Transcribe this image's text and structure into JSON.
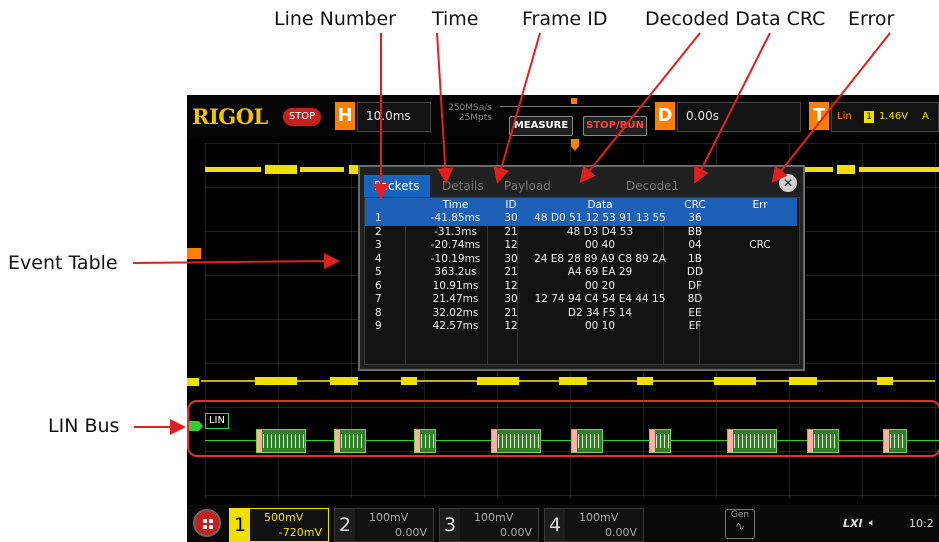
{
  "callouts": {
    "line_number": "Line Number",
    "time": "Time",
    "frame_id": "Frame ID",
    "decoded_data_crc": "Decoded Data CRC",
    "error": "Error",
    "event_table": "Event Table",
    "lin_bus": "LIN Bus"
  },
  "colors": {
    "callout_arrow": "#e02020",
    "accent_blue": "#1e5fb8",
    "trigger_orange": "#ff7f00",
    "channel1_yellow": "#f0e000",
    "lin_green": "#2ad12a"
  },
  "topbar": {
    "brand": "RIGOL",
    "run_state": "STOP",
    "horizontal_badge": "H",
    "timebase": "10.0ms",
    "sample_rate": "250MSa/s",
    "memory_depth": "25Mpts",
    "measure_label": "MEASURE",
    "stop_run_label": "STOP/RUN",
    "delay_badge": "D",
    "delay_value": "0.00s",
    "trigger_badge": "T",
    "trigger_type": "Lin",
    "trigger_channel": "1",
    "trigger_level": "1.46V",
    "trigger_mode": "A"
  },
  "event_table": {
    "tabs": [
      "Packets",
      "Details",
      "Payload",
      "Decode1"
    ],
    "active_tab": "Packets",
    "close_icon": "close-icon",
    "columns": [
      "",
      "Time",
      "ID",
      "Data",
      "CRC",
      "Err"
    ],
    "rows": [
      {
        "n": "1",
        "time": "-41.85ms",
        "id": "30",
        "data": "48 D0 51 12 53 91 13 55",
        "crc": "36",
        "err": ""
      },
      {
        "n": "2",
        "time": "-31.3ms",
        "id": "21",
        "data": "48 D3 D4 53",
        "crc": "BB",
        "err": ""
      },
      {
        "n": "3",
        "time": "-20.74ms",
        "id": "12",
        "data": "00 40",
        "crc": "04",
        "err": "CRC"
      },
      {
        "n": "4",
        "time": "-10.19ms",
        "id": "30",
        "data": "24 E8 28 89 A9 C8 89 2A",
        "crc": "1B",
        "err": ""
      },
      {
        "n": "5",
        "time": "363.2us",
        "id": "21",
        "data": "A4 69 EA 29",
        "crc": "DD",
        "err": ""
      },
      {
        "n": "6",
        "time": "10.91ms",
        "id": "12",
        "data": "00 20",
        "crc": "DF",
        "err": ""
      },
      {
        "n": "7",
        "time": "21.47ms",
        "id": "30",
        "data": "12 74 94 C4 54 E4 44 15",
        "crc": "8D",
        "err": ""
      },
      {
        "n": "8",
        "time": "32.02ms",
        "id": "21",
        "data": "D2 34 F5 14",
        "crc": "EE",
        "err": ""
      },
      {
        "n": "9",
        "time": "42.57ms",
        "id": "12",
        "data": "00 10",
        "crc": "EF",
        "err": ""
      }
    ]
  },
  "waveform": {
    "channel1_marker": "1",
    "lin_label": "LIN"
  },
  "bottombar": {
    "channels": [
      {
        "num": "1",
        "scale": "500mV",
        "offset": "-720mV",
        "active": true
      },
      {
        "num": "2",
        "scale": "100mV",
        "offset": "0.00V",
        "active": false
      },
      {
        "num": "3",
        "scale": "100mV",
        "offset": "0.00V",
        "active": false
      },
      {
        "num": "4",
        "scale": "100mV",
        "offset": "0.00V",
        "active": false
      }
    ],
    "gen_label": "Gen",
    "lxi_label": "LXI",
    "clock": "10:2"
  }
}
